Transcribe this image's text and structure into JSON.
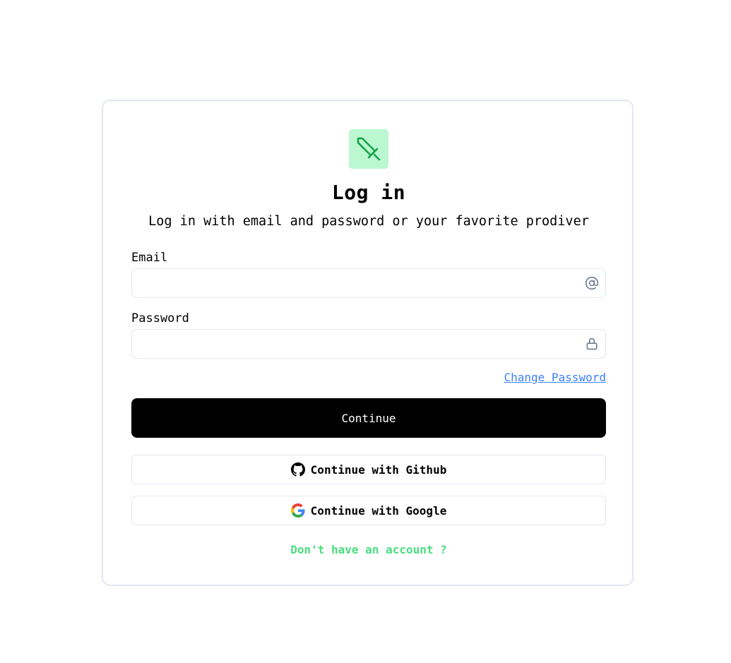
{
  "header": {
    "logo_icon": "sword-icon",
    "title": "Log in",
    "subtitle": "Log in with email and password or your favorite prodiver"
  },
  "form": {
    "email_label": "Email",
    "email_value": "",
    "email_icon": "at-sign-icon",
    "password_label": "Password",
    "password_value": "",
    "password_icon": "lock-icon",
    "change_password_link": "Change Password",
    "submit_label": "Continue"
  },
  "oauth": {
    "github_label": "Continue with Github",
    "github_icon": "github-icon",
    "google_label": "Continue with Google",
    "google_icon": "google-icon"
  },
  "footer": {
    "signup_link": "Don't have an account ?"
  },
  "colors": {
    "accent_green": "#4ade80",
    "logo_bg": "#bbf7d0",
    "logo_fg": "#16a34a",
    "link_blue": "#3b82f6",
    "primary_button": "#000000",
    "border": "#e2e8f0"
  }
}
